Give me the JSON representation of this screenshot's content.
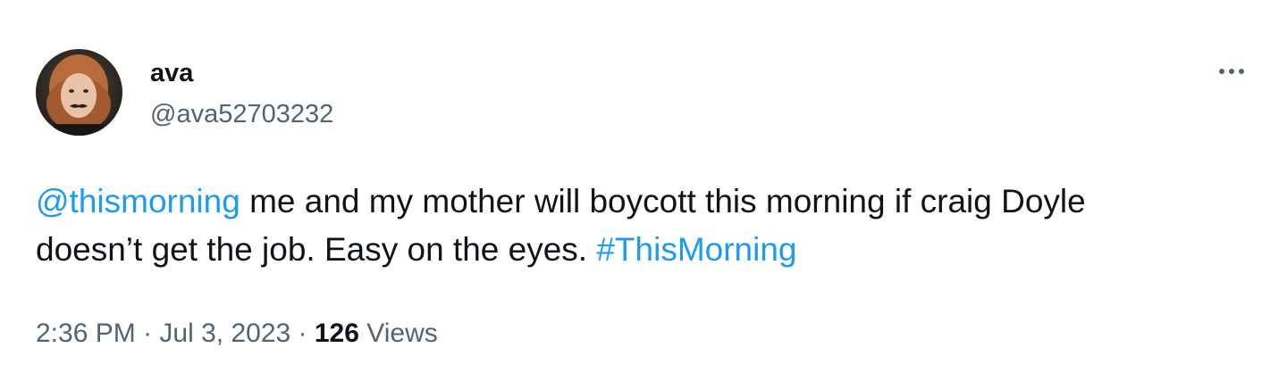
{
  "user": {
    "display_name": "ava",
    "handle": "@ava52703232"
  },
  "tweet": {
    "mention": "@thismorning",
    "body_line1": " me and my mother will boycott this morning if craig Doyle",
    "body_line2": "doesn’t get the job. Easy on the eyes. ",
    "hashtag": "#ThisMorning"
  },
  "meta": {
    "time": "2:36 PM",
    "separator1": " · ",
    "date": "Jul 3, 2023",
    "separator2": " · ",
    "views_count": "126",
    "views_label": " Views"
  },
  "icons": {
    "more": "more-horizontal-icon",
    "avatar": "avatar-image"
  },
  "colors": {
    "link": "#1d9bf0",
    "secondary_text": "#536471",
    "primary_text": "#0f1419"
  }
}
